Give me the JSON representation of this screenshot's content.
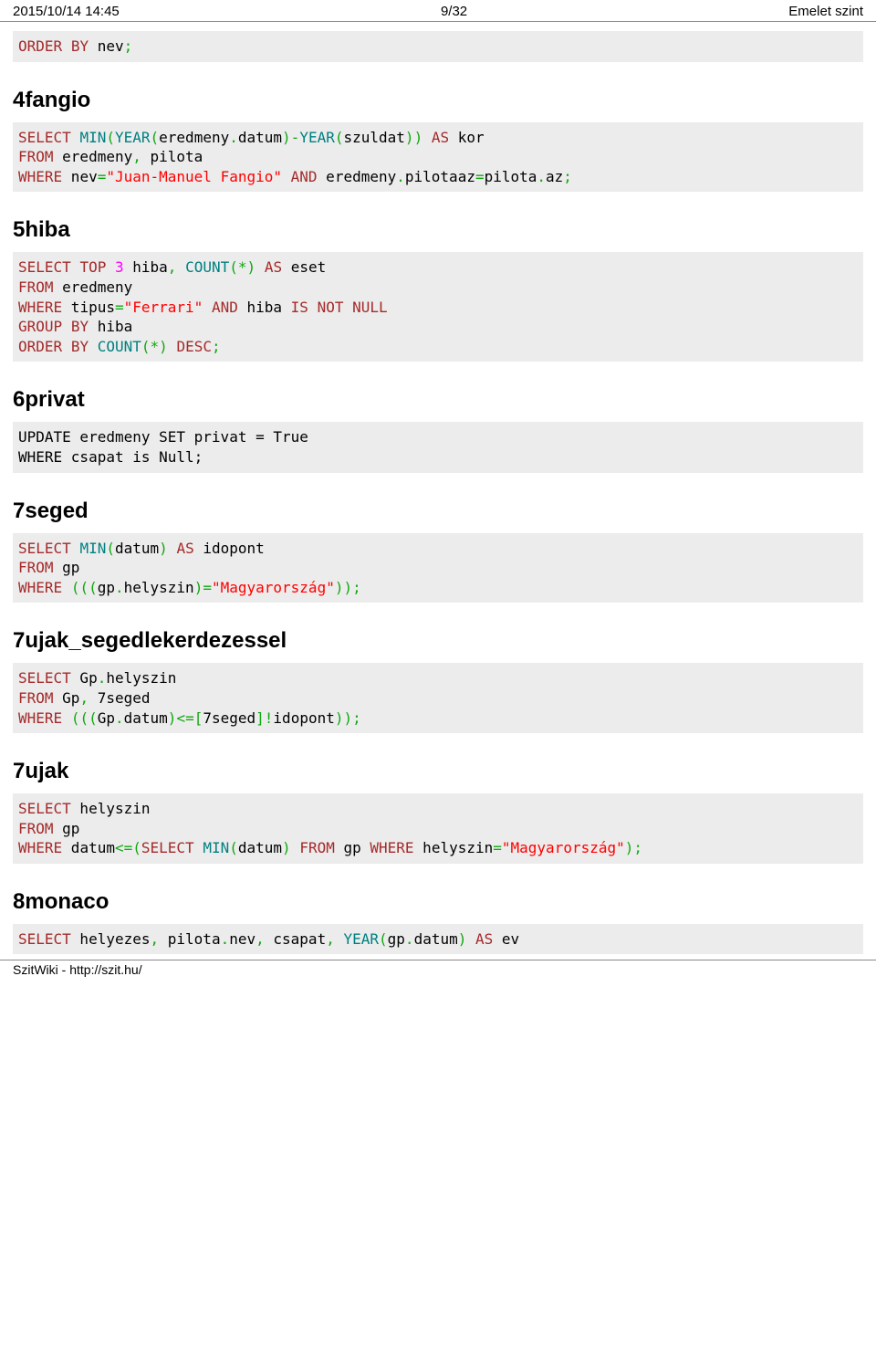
{
  "header": {
    "left": "2015/10/14 14:45",
    "center": "9/32",
    "right": "Emelet szint"
  },
  "sections": {
    "h_4fangio": "4fangio",
    "h_5hiba": "5hiba",
    "h_6privat": "6privat",
    "h_7seged": "7seged",
    "h_7ujak_seged": "7ujak_segedlekerdezessel",
    "h_7ujak": "7ujak",
    "h_8monaco": "8monaco"
  },
  "footer": "SzitWiki - http://szit.hu/",
  "code": {
    "block1": {
      "kw_order": "ORDER",
      "kw_by": "BY",
      "id_nev": " nev",
      "semi": ";"
    },
    "block2": {
      "kw_select": "SELECT",
      "fn_min": "MIN",
      "lp1": "(",
      "fn_year1": "YEAR",
      "lp2": "(",
      "id_eredmeny_datum1": "eredmeny",
      "dot1": ".",
      "id_datum1": "datum",
      "rp2": ")",
      "minus": "-",
      "fn_year2": "YEAR",
      "lp3": "(",
      "id_szuldat": "szuldat",
      "rp3": ")",
      "rp1": ")",
      "kw_as": "AS",
      "id_kor": " kor",
      "kw_from": "FROM",
      "id_from": " eredmeny",
      "comma_from": ",",
      "id_pilota": " pilota",
      "kw_where": "WHERE",
      "id_nev": " nev",
      "eq1": "=",
      "str_fangio": "\"Juan-Manuel Fangio\"",
      "kw_and": "AND",
      "id_eredmeny2": " eredmeny",
      "dot2": ".",
      "id_pilotaaz": "pilotaaz",
      "eq2": "=",
      "id_pilota2": "pilota",
      "dot3": ".",
      "id_az": "az",
      "semi": ";"
    },
    "block3": {
      "kw_select": "SELECT",
      "kw_top": "TOP",
      "num3": "3",
      "id_hiba": " hiba",
      "comma1": ",",
      "fn_count": "COUNT",
      "lp1": "(",
      "star": "*",
      "rp1": ")",
      "kw_as": "AS",
      "id_eset": " eset",
      "kw_from": "FROM",
      "id_eredmeny": " eredmeny",
      "kw_where": "WHERE",
      "id_tipus": " tipus",
      "eq1": "=",
      "str_ferrari": "\"Ferrari\"",
      "kw_and": "AND",
      "id_hiba2": " hiba ",
      "kw_is": "IS",
      "kw_not": "NOT",
      "kw_null": "NULL",
      "kw_group": "GROUP",
      "kw_by1": "BY",
      "id_hiba3": " hiba",
      "kw_order": "ORDER",
      "kw_by2": "BY",
      "fn_count2": "COUNT",
      "lp2": "(",
      "star2": "*",
      "rp2": ")",
      "kw_desc": "DESC",
      "semi": ";"
    },
    "block4": {
      "line1": "UPDATE eredmeny SET privat = True",
      "line2": "WHERE csapat is Null;"
    },
    "block5": {
      "kw_select": "SELECT",
      "fn_min": "MIN",
      "lp1": "(",
      "id_datum": "datum",
      "rp1": ")",
      "kw_as": "AS",
      "id_idopont": " idopont",
      "kw_from": "FROM",
      "id_gp": " gp",
      "kw_where": "WHERE",
      "lp2": "(((",
      "id_gp2": "gp",
      "dot": ".",
      "id_helyszin": "helyszin",
      "rp2": ")",
      "eq": "=",
      "str_mo": "\"Magyarország\"",
      "rp3": "))",
      "semi": ";"
    },
    "block6": {
      "kw_select": "SELECT",
      "id_gp": " Gp",
      "dot1": ".",
      "id_helyszin": "helyszin",
      "kw_from": "FROM",
      "id_from": " Gp",
      "comma": ",",
      "id_7seged": " 7seged",
      "kw_where": "WHERE",
      "lp1": "(((",
      "id_gp2": "Gp",
      "dot2": ".",
      "id_datum": "datum",
      "rp1": ")",
      "le": "<=",
      "lb": "[",
      "id_7seged2": "7seged",
      "rb": "]",
      "bang": "!",
      "id_idopont": "idopont",
      "rp2": "))",
      "semi": ";"
    },
    "block7": {
      "kw_select": "SELECT",
      "id_helyszin": " helyszin",
      "kw_from": "FROM",
      "id_gp": " gp",
      "kw_where": "WHERE",
      "id_datum": " datum",
      "le": "<=",
      "lp1": "(",
      "kw_select2": "SELECT",
      "fn_min": "MIN",
      "lp2": "(",
      "id_datum2": "datum",
      "rp2": ")",
      "kw_from2": "FROM",
      "id_gp2": " gp ",
      "kw_where2": "WHERE",
      "id_helyszin2": " helyszin",
      "eq": "=",
      "str_mo": "\"Magyarország\"",
      "rp1": ")",
      "semi": ";"
    },
    "block8": {
      "kw_select": "SELECT",
      "id_helyezes": " helyezes",
      "comma1": ",",
      "id_pilota": " pilota",
      "dot1": ".",
      "id_nev": "nev",
      "comma2": ",",
      "id_csapat": " csapat",
      "comma3": ",",
      "fn_year": "YEAR",
      "lp1": "(",
      "id_gp": "gp",
      "dot2": ".",
      "id_datum": "datum",
      "rp1": ")",
      "kw_as": "AS",
      "id_ev": " ev"
    }
  }
}
